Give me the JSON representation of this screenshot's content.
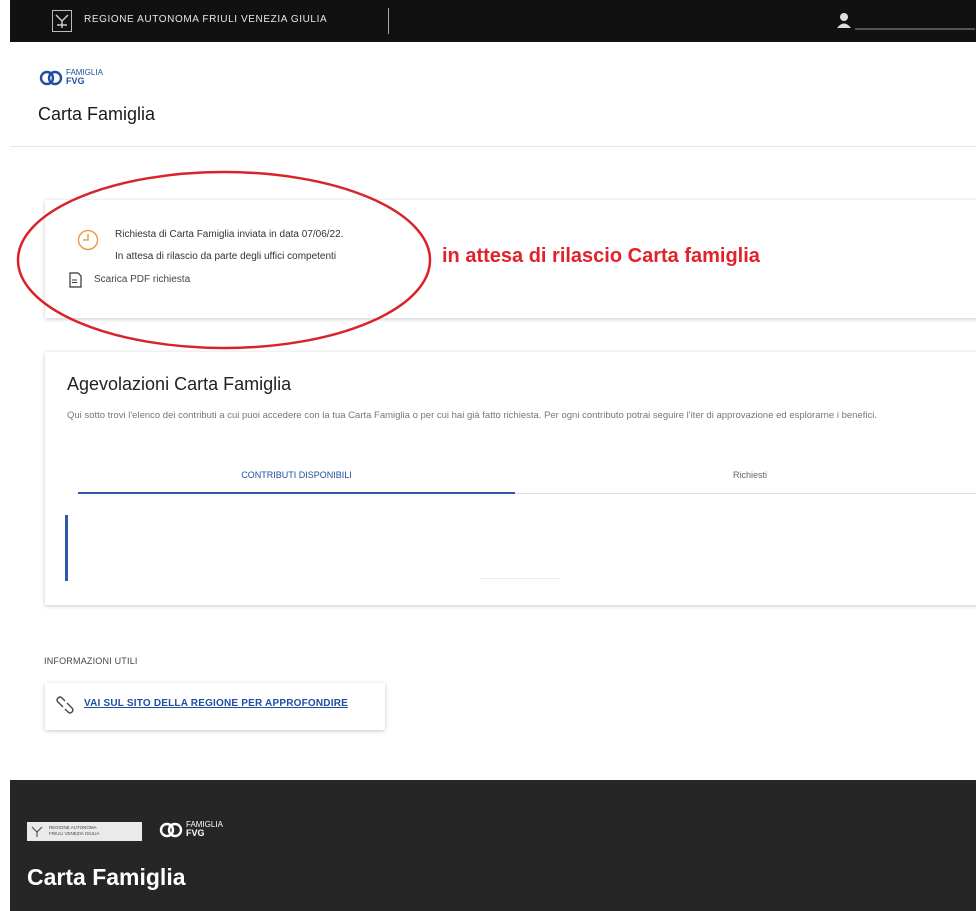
{
  "topbar": {
    "region_name": "REGIONE AUTONOMA FRIULI VENEZIA GIULIA",
    "bg_color": "#111111"
  },
  "header": {
    "logo_line1": "FAMIGLIA",
    "logo_line2": "FVG",
    "title": "Carta Famiglia"
  },
  "status": {
    "line1": "Richiesta di Carta Famiglia inviata in data 07/06/22.",
    "line2": "In attesa di rilascio da parte degli uffici competenti",
    "pdf_link": "Scarica PDF richiesta",
    "annotation": "in attesa di rilascio Carta famiglia",
    "annotation_color": "#e0232a"
  },
  "agevolazioni": {
    "title": "Agevolazioni Carta Famiglia",
    "description": "Qui sotto trovi l'elenco dei contributi a cui puoi accedere con la tua Carta Famiglia o per cui hai già fatto richiesta. Per ogni contributo potrai seguire l'iter di approvazione ed esplorarne i benefici.",
    "tabs": [
      {
        "label": "CONTRIBUTI DISPONIBILI",
        "active": true
      },
      {
        "label": "Richiesti",
        "active": false
      }
    ]
  },
  "info": {
    "label": "INFORMAZIONI UTILI",
    "link": "VAI SUL SITO DELLA REGIONE PER APPROFONDIRE"
  },
  "footer": {
    "region_line1": "REGIONE AUTONOMA",
    "region_line2": "FRIULI VENEZIA GIULIA",
    "logo_line1": "FAMIGLIA",
    "logo_line2": "FVG",
    "title": "Carta Famiglia",
    "bg_color": "#262626"
  },
  "accent_color": "#1f4fa0"
}
